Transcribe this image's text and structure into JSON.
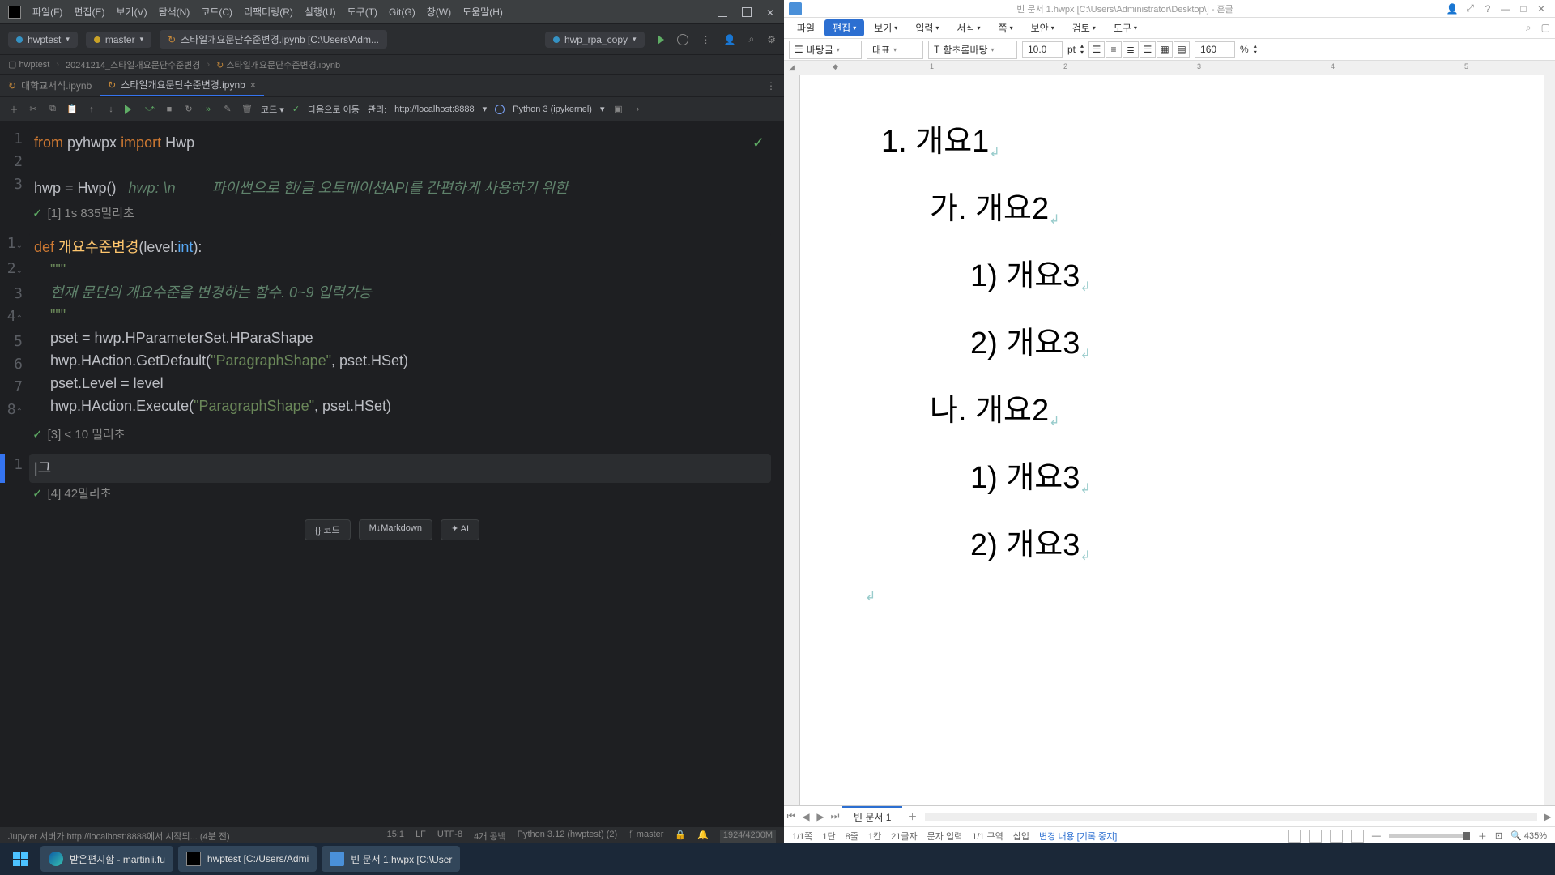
{
  "ide": {
    "menu": [
      "파일(F)",
      "편집(E)",
      "보기(V)",
      "탐색(N)",
      "코드(C)",
      "리팩터링(R)",
      "실행(U)",
      "도구(T)",
      "Git(G)",
      "창(W)",
      "도움말(H)"
    ],
    "project": "hwptest",
    "branch": "master",
    "open_nb": "스타일개요문단수준변경.ipynb [C:\\Users\\Adm...",
    "run_cfg": "hwp_rpa_copy",
    "breadcrumbs": [
      "hwptest",
      "20241214_스타일개요문단수준변경",
      "스타일개요문단수준변경.ipynb"
    ],
    "tabs": [
      {
        "label": "대학교서식.ipynb",
        "active": false
      },
      {
        "label": "스타일개요문단수준변경.ipynb",
        "active": true
      }
    ],
    "actionbar": {
      "code": "코드",
      "next": "다음으로 이동",
      "manage": "관리:",
      "url": "http://localhost:8888",
      "kernel": "Python 3 (ipykernel)"
    },
    "cells": {
      "c1": {
        "lines": [
          "from",
          "pyhwpx",
          "import",
          "Hwp"
        ],
        "l3": "hwp = Hwp()",
        "hint": "hwp: \\n",
        "desc": "파이썬으로 한/글 오토메이션API를 간편하게 사용하기 위한 ",
        "out": "[1] 1s 835밀리초"
      },
      "c2": {
        "def": "def",
        "name": "개요수준변경",
        "sig": "(level:",
        "type": "int",
        "close": "):",
        "doc": "현재 문단의 개요수준을 변경하는 함수. 0~9 입력가능",
        "l5": "pset = hwp.HParameterSet.HParaShape",
        "l6a": "hwp.HAction.GetDefault(",
        "l6s": "\"ParagraphShape\"",
        "l6b": ", pset.HSet)",
        "l7": "pset.Level = level",
        "l8a": "hwp.HAction.Execute(",
        "l8s": "\"ParagraphShape\"",
        "l8b": ", pset.HSet)",
        "out": "[3] < 10 밀리초"
      },
      "c3": {
        "content": "|그",
        "out": "[4] 42밀리초"
      }
    },
    "addchips": [
      "코드",
      "M↓Markdown",
      "AI"
    ],
    "status": {
      "left": "Jupyter 서버가 http://localhost:8888에서 시작되... (4분 전)",
      "pos": "15:1",
      "lf": "LF",
      "enc": "UTF-8",
      "sp": "4개 공백",
      "py": "Python 3.12 (hwptest) (2)",
      "br": "master",
      "mem": "1924/4200M"
    }
  },
  "wp": {
    "title": "빈 문서 1.hwpx [C:\\Users\\Administrator\\Desktop\\] - 훈글",
    "menu": [
      "파일",
      "편집",
      "보기",
      "입력",
      "서식",
      "쪽",
      "보안",
      "검토",
      "도구"
    ],
    "toolbar": {
      "style": "바탕글",
      "inst": "대표",
      "font": "함초롬바탕",
      "size": "10.0",
      "unit": "pt",
      "zoom": "160",
      "pct": "%"
    },
    "ruler": [
      "1",
      "2",
      "3",
      "4",
      "5"
    ],
    "body": [
      {
        "cls": "l1",
        "t": "1. 개요1"
      },
      {
        "cls": "l2",
        "t": "가. 개요2"
      },
      {
        "cls": "l3",
        "t": "1) 개요3"
      },
      {
        "cls": "l3",
        "t": "2) 개요3"
      },
      {
        "cls": "l2",
        "t": "나. 개요2"
      },
      {
        "cls": "l3",
        "t": "1) 개요3"
      },
      {
        "cls": "l3",
        "t": "2) 개요3"
      }
    ],
    "doctab": "빈 문서 1",
    "status": {
      "page": "1/1쪽",
      "dan": "1단",
      "line": "8줄",
      "col": "1칸",
      "chars": "21글자",
      "mode": "문자 입력",
      "sec": "1/1 구역",
      "ins": "삽입",
      "rec": "변경 내용 [기록 중지]",
      "zoom": "435%"
    }
  },
  "taskbar": {
    "mail": "받은편지함 - martinii.fu",
    "ide": "hwptest [C:/Users/Admi",
    "hwp": "빈 문서 1.hwpx [C:\\User"
  }
}
